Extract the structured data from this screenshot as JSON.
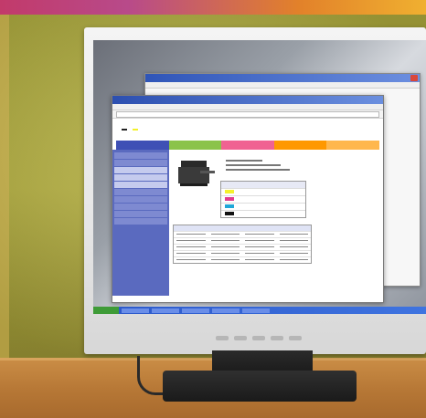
{
  "scene": {
    "description_colors": {
      "wall": "#a7a43a",
      "desk": "#b77836",
      "monitor_bezel": "#e6e6e6",
      "stand": "#1a1a1a"
    }
  },
  "back_window": {
    "title": "",
    "menu": []
  },
  "front_window": {
    "title": "",
    "menu": [],
    "address": "",
    "header": {
      "device_label": "",
      "status_1": "",
      "status_2": ""
    },
    "tabs": [
      "",
      "",
      "",
      "",
      ""
    ],
    "sidebar": [
      "",
      "",
      "",
      "",
      "",
      "",
      "",
      "",
      "",
      ""
    ]
  },
  "icons": {
    "close": "close-icon",
    "printer": "printer-icon"
  }
}
